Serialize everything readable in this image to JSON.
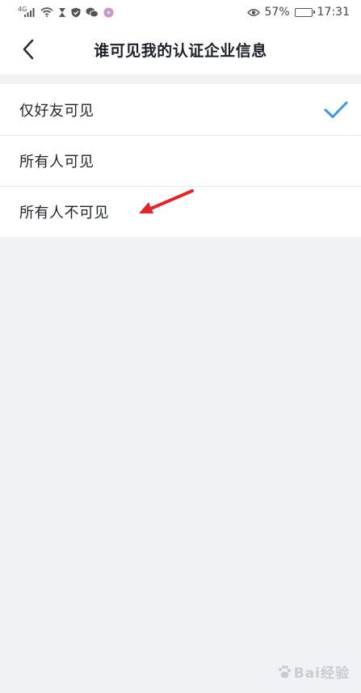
{
  "status_bar": {
    "network_label": "4G",
    "battery_percent": "57%",
    "battery_level": 0.57,
    "time": "17:31"
  },
  "nav": {
    "back_icon": "chevron-left-icon",
    "title": "谁可见我的认证企业信息"
  },
  "options": [
    {
      "label": "仅好友可见",
      "selected": true
    },
    {
      "label": "所有人可见",
      "selected": false
    },
    {
      "label": "所有人不可见",
      "selected": false
    }
  ],
  "accent_color": "#3a96f0",
  "annotation_arrow_color": "#e1252b",
  "watermark": {
    "text": "Bai经验"
  }
}
